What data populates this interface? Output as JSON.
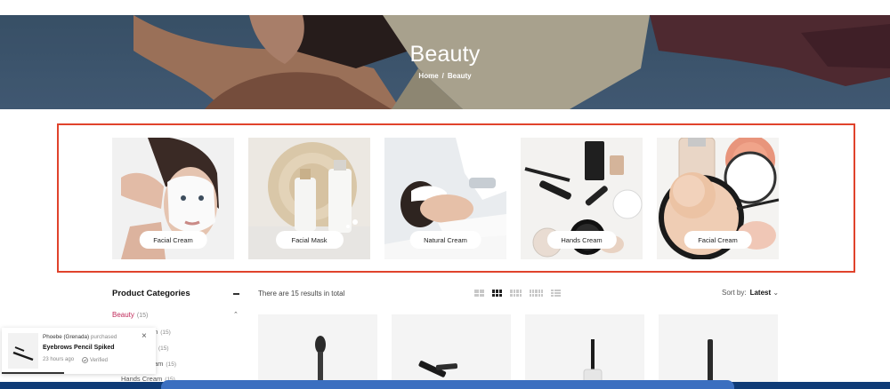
{
  "hero": {
    "title": "Beauty",
    "breadcrumb": {
      "home": "Home",
      "separator": "/",
      "current": "Beauty"
    }
  },
  "categories": [
    {
      "label": "Facial Cream"
    },
    {
      "label": "Facial Mask"
    },
    {
      "label": "Natural Cream"
    },
    {
      "label": "Hands Cream"
    },
    {
      "label": "Facial Cream"
    }
  ],
  "sidebar": {
    "title": "Product Categories",
    "active": {
      "label": "Beauty",
      "count": "(15)"
    },
    "items": [
      {
        "label": "m",
        "count": "(15)"
      },
      {
        "label": "",
        "count": "(15)"
      },
      {
        "label": "am",
        "count": "(15)"
      },
      {
        "label": "Hands Cream",
        "count": "(15)"
      }
    ]
  },
  "toolbar": {
    "results_text": "There are 15 results in total",
    "sort_label": "Sort by:",
    "sort_value": "Latest"
  },
  "toast": {
    "buyer": "Phoebe (Grenada)",
    "action": "purchased",
    "product": "Eyebrows Pencil Spiked",
    "time": "23 hours ago",
    "verified": "Verified"
  },
  "colors": {
    "accent": "#c02a5a",
    "highlight_frame": "#e0432c",
    "hero_bg": "#4a6785",
    "bottom_bar": "#0f3b76"
  }
}
